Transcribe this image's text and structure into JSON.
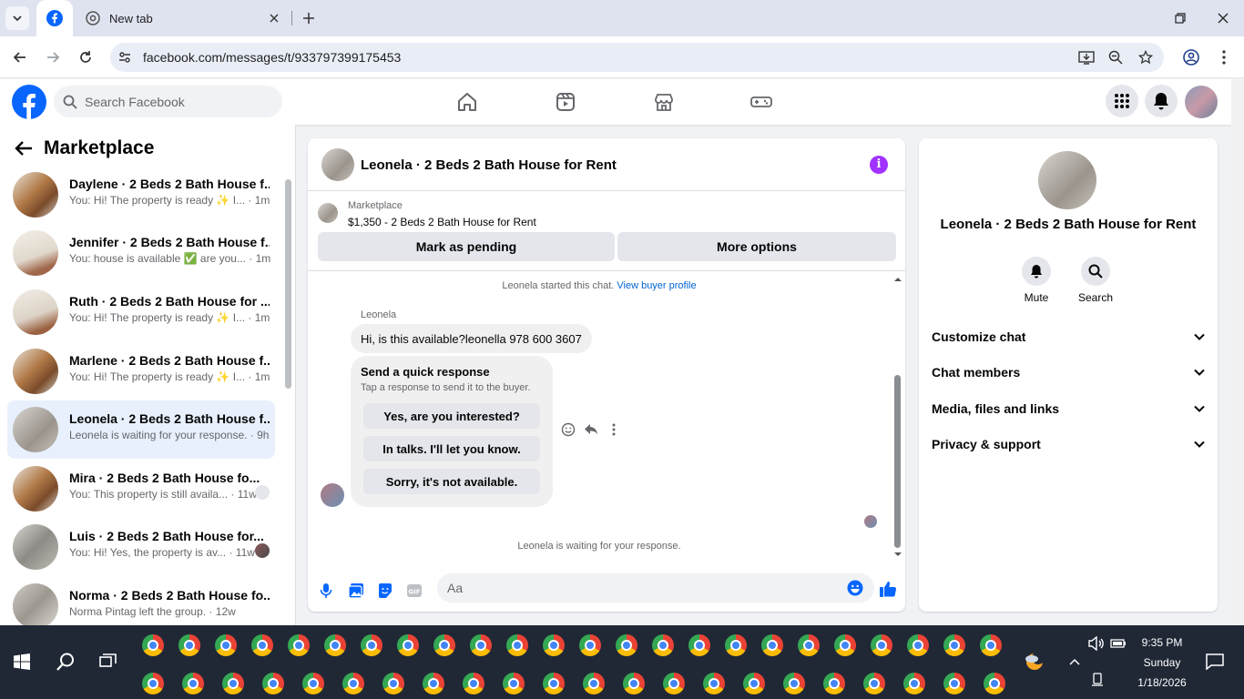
{
  "browser": {
    "tabs": [
      {
        "label": ""
      },
      {
        "label": "New tab"
      }
    ],
    "url": "facebook.com/messages/t/933797399175453"
  },
  "header": {
    "search_placeholder": "Search Facebook"
  },
  "left": {
    "title": "Marketplace",
    "conversations": [
      {
        "name": "Daylene · 2 Beds 2 Bath House f...",
        "snippet": "You: Hi! The property is ready ✨ I...",
        "time": "1m"
      },
      {
        "name": "Jennifer · 2 Beds 2 Bath House f...",
        "snippet": "You: house is available ✅ are you...",
        "time": "1m"
      },
      {
        "name": "Ruth · 2 Beds 2 Bath House for ...",
        "snippet": "You: Hi! The property is ready ✨ I...",
        "time": "1m"
      },
      {
        "name": "Marlene · 2 Beds 2 Bath House f...",
        "snippet": "You: Hi! The property is ready ✨ I...",
        "time": "1m"
      },
      {
        "name": "Leonela · 2 Beds 2 Bath House f...",
        "snippet": "Leonela is waiting for your response.",
        "time": "9h"
      },
      {
        "name": "Mira · 2 Beds 2 Bath House fo...",
        "snippet": "You: This property is still availa...",
        "time": "11w"
      },
      {
        "name": "Luis · 2 Beds 2 Bath House for...",
        "snippet": "You: Hi! Yes, the property is av...",
        "time": "11w"
      },
      {
        "name": "Norma · 2 Beds 2 Bath House fo...",
        "snippet": "Norma Pintag left the group.",
        "time": "12w"
      }
    ]
  },
  "chat": {
    "title": "Leonela · 2 Beds 2 Bath House for Rent",
    "info_label": "i",
    "marketplace_label": "Marketplace",
    "listing": "$1,350 - 2 Beds 2 Bath House for Rent",
    "mark_pending": "Mark as pending",
    "more_options": "More options",
    "started_text": "Leonela started this chat.",
    "view_profile": "View buyer profile",
    "sender_name": "Leonela",
    "message": "Hi, is this available?leonella 978 600 3607",
    "quick_title": "Send a quick response",
    "quick_sub": "Tap a response to send it to the buyer.",
    "quick_replies": [
      "Yes, are you interested?",
      "In talks. I'll let you know.",
      "Sorry, it's not available."
    ],
    "waiting_text": "Leonela is waiting for your response.",
    "input_placeholder": "Aa"
  },
  "right": {
    "name": "Leonela · 2 Beds 2 Bath House for Rent",
    "mute": "Mute",
    "search": "Search",
    "sections": [
      "Customize chat",
      "Chat members",
      "Media, files and links",
      "Privacy & support"
    ]
  },
  "taskbar": {
    "time": "9:35 PM",
    "day": "Sunday",
    "date": "1/18/2026"
  },
  "colors": {
    "fb_blue": "#0866ff",
    "accent_purple": "#a033ff",
    "taskbar": "#202836"
  }
}
